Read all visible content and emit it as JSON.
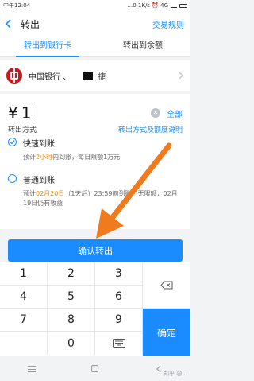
{
  "status_bar": {
    "time": "中午12:04",
    "net": "...0.1K/s ⏰ 4G"
  },
  "nav": {
    "title": "转出",
    "right_link": "交易规则"
  },
  "tabs": [
    {
      "label": "转出到银行卡",
      "active": true
    },
    {
      "label": "转出到余额",
      "active": false
    }
  ],
  "bank": {
    "name": "中国银行 、",
    "suffix": "捷"
  },
  "amount": {
    "symbol": "¥",
    "value": "1",
    "all_label": "全部"
  },
  "method": {
    "header": "转出方式",
    "header_link": "转出方式及额度说明",
    "options": [
      {
        "title": "快速到账",
        "desc_pre": "预计",
        "desc_hl": "2小时",
        "desc_post": "内到账，每日限额1万元",
        "checked": true
      },
      {
        "title": "普通到账",
        "desc_pre": "预计",
        "desc_hl": "02月20日",
        "desc_post": "（1天后）23:59前到账，无限额，02月19日仍有收益",
        "checked": false
      }
    ]
  },
  "confirm_button": "确认转出",
  "keypad": {
    "keys": [
      "1",
      "2",
      "3",
      "4",
      "5",
      "6",
      "7",
      "8",
      "9",
      "0"
    ],
    "ok_label": "确定"
  },
  "watermark": "知乎 @..."
}
